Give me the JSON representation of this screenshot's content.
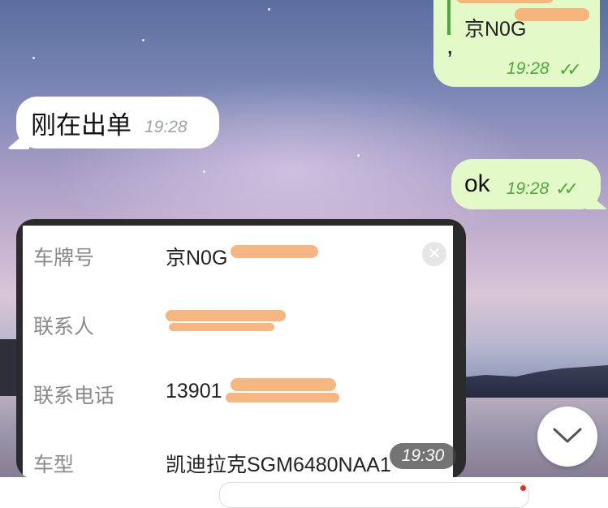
{
  "chat": {
    "top_message": {
      "quote_text": "京N0G",
      "text": ",",
      "time": "19:28"
    },
    "incoming_message": {
      "text": "刚在出单",
      "time": "19:28"
    },
    "ok_message": {
      "text": "ok",
      "time": "19:28"
    },
    "image_message": {
      "time": "19:30",
      "fields": [
        {
          "label": "车牌号",
          "value": "京N0G"
        },
        {
          "label": "联系人",
          "value": ""
        },
        {
          "label": "联系电话",
          "value": "13901"
        },
        {
          "label": "车型",
          "value": "凯迪拉克SGM6480NAA1"
        }
      ]
    }
  },
  "icons": {
    "ticks": "double-check-icon",
    "close": "close-circle-icon",
    "scroll": "chevron-down-icon"
  },
  "colors": {
    "outgoing_bubble": "#e4f9c8",
    "incoming_bubble": "#ffffff",
    "tick_green": "#4ea83c",
    "redaction": "#f6b27a"
  }
}
